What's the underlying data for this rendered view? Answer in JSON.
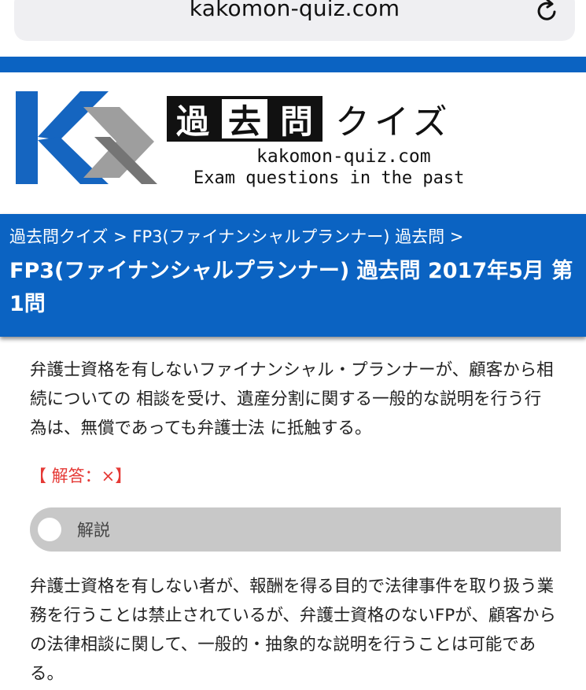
{
  "browser": {
    "url": "kakomon-quiz.com",
    "reload_icon": "reload-icon"
  },
  "colors": {
    "brand_blue": "#0b63c2",
    "answer_red": "#e53935",
    "accordion_gray": "#c8c8c8"
  },
  "logo": {
    "kanji": [
      "過",
      "去",
      "問"
    ],
    "kana": "クイズ",
    "domain": "kakomon-quiz.com",
    "tagline": "Exam questions in the past"
  },
  "breadcrumb": {
    "home": "過去問クイズ",
    "sep1": ">",
    "category": "FP3(ファイナンシャルプランナー) 過去問",
    "sep2": ">"
  },
  "page_title": "FP3(ファイナンシャルプランナー) 過去問 2017年5月 第1問",
  "question": "弁護士資格を有しないファイナンシャル・プランナーが、顧客から相続についての 相談を受け、遺産分割に関する一般的な説明を行う行為は、無償であっても弁護士法 に抵触する。",
  "answer": "【 解答：×】",
  "accordion_label": "解説",
  "explanation": "弁護士資格を有しない者が、報酬を得る目的で法律事件を取り扱う業務を行うことは禁止されているが、弁護士資格のないFPが、顧客からの法律相談に関して、一般的・抽象的な説明を行うことは可能である。"
}
